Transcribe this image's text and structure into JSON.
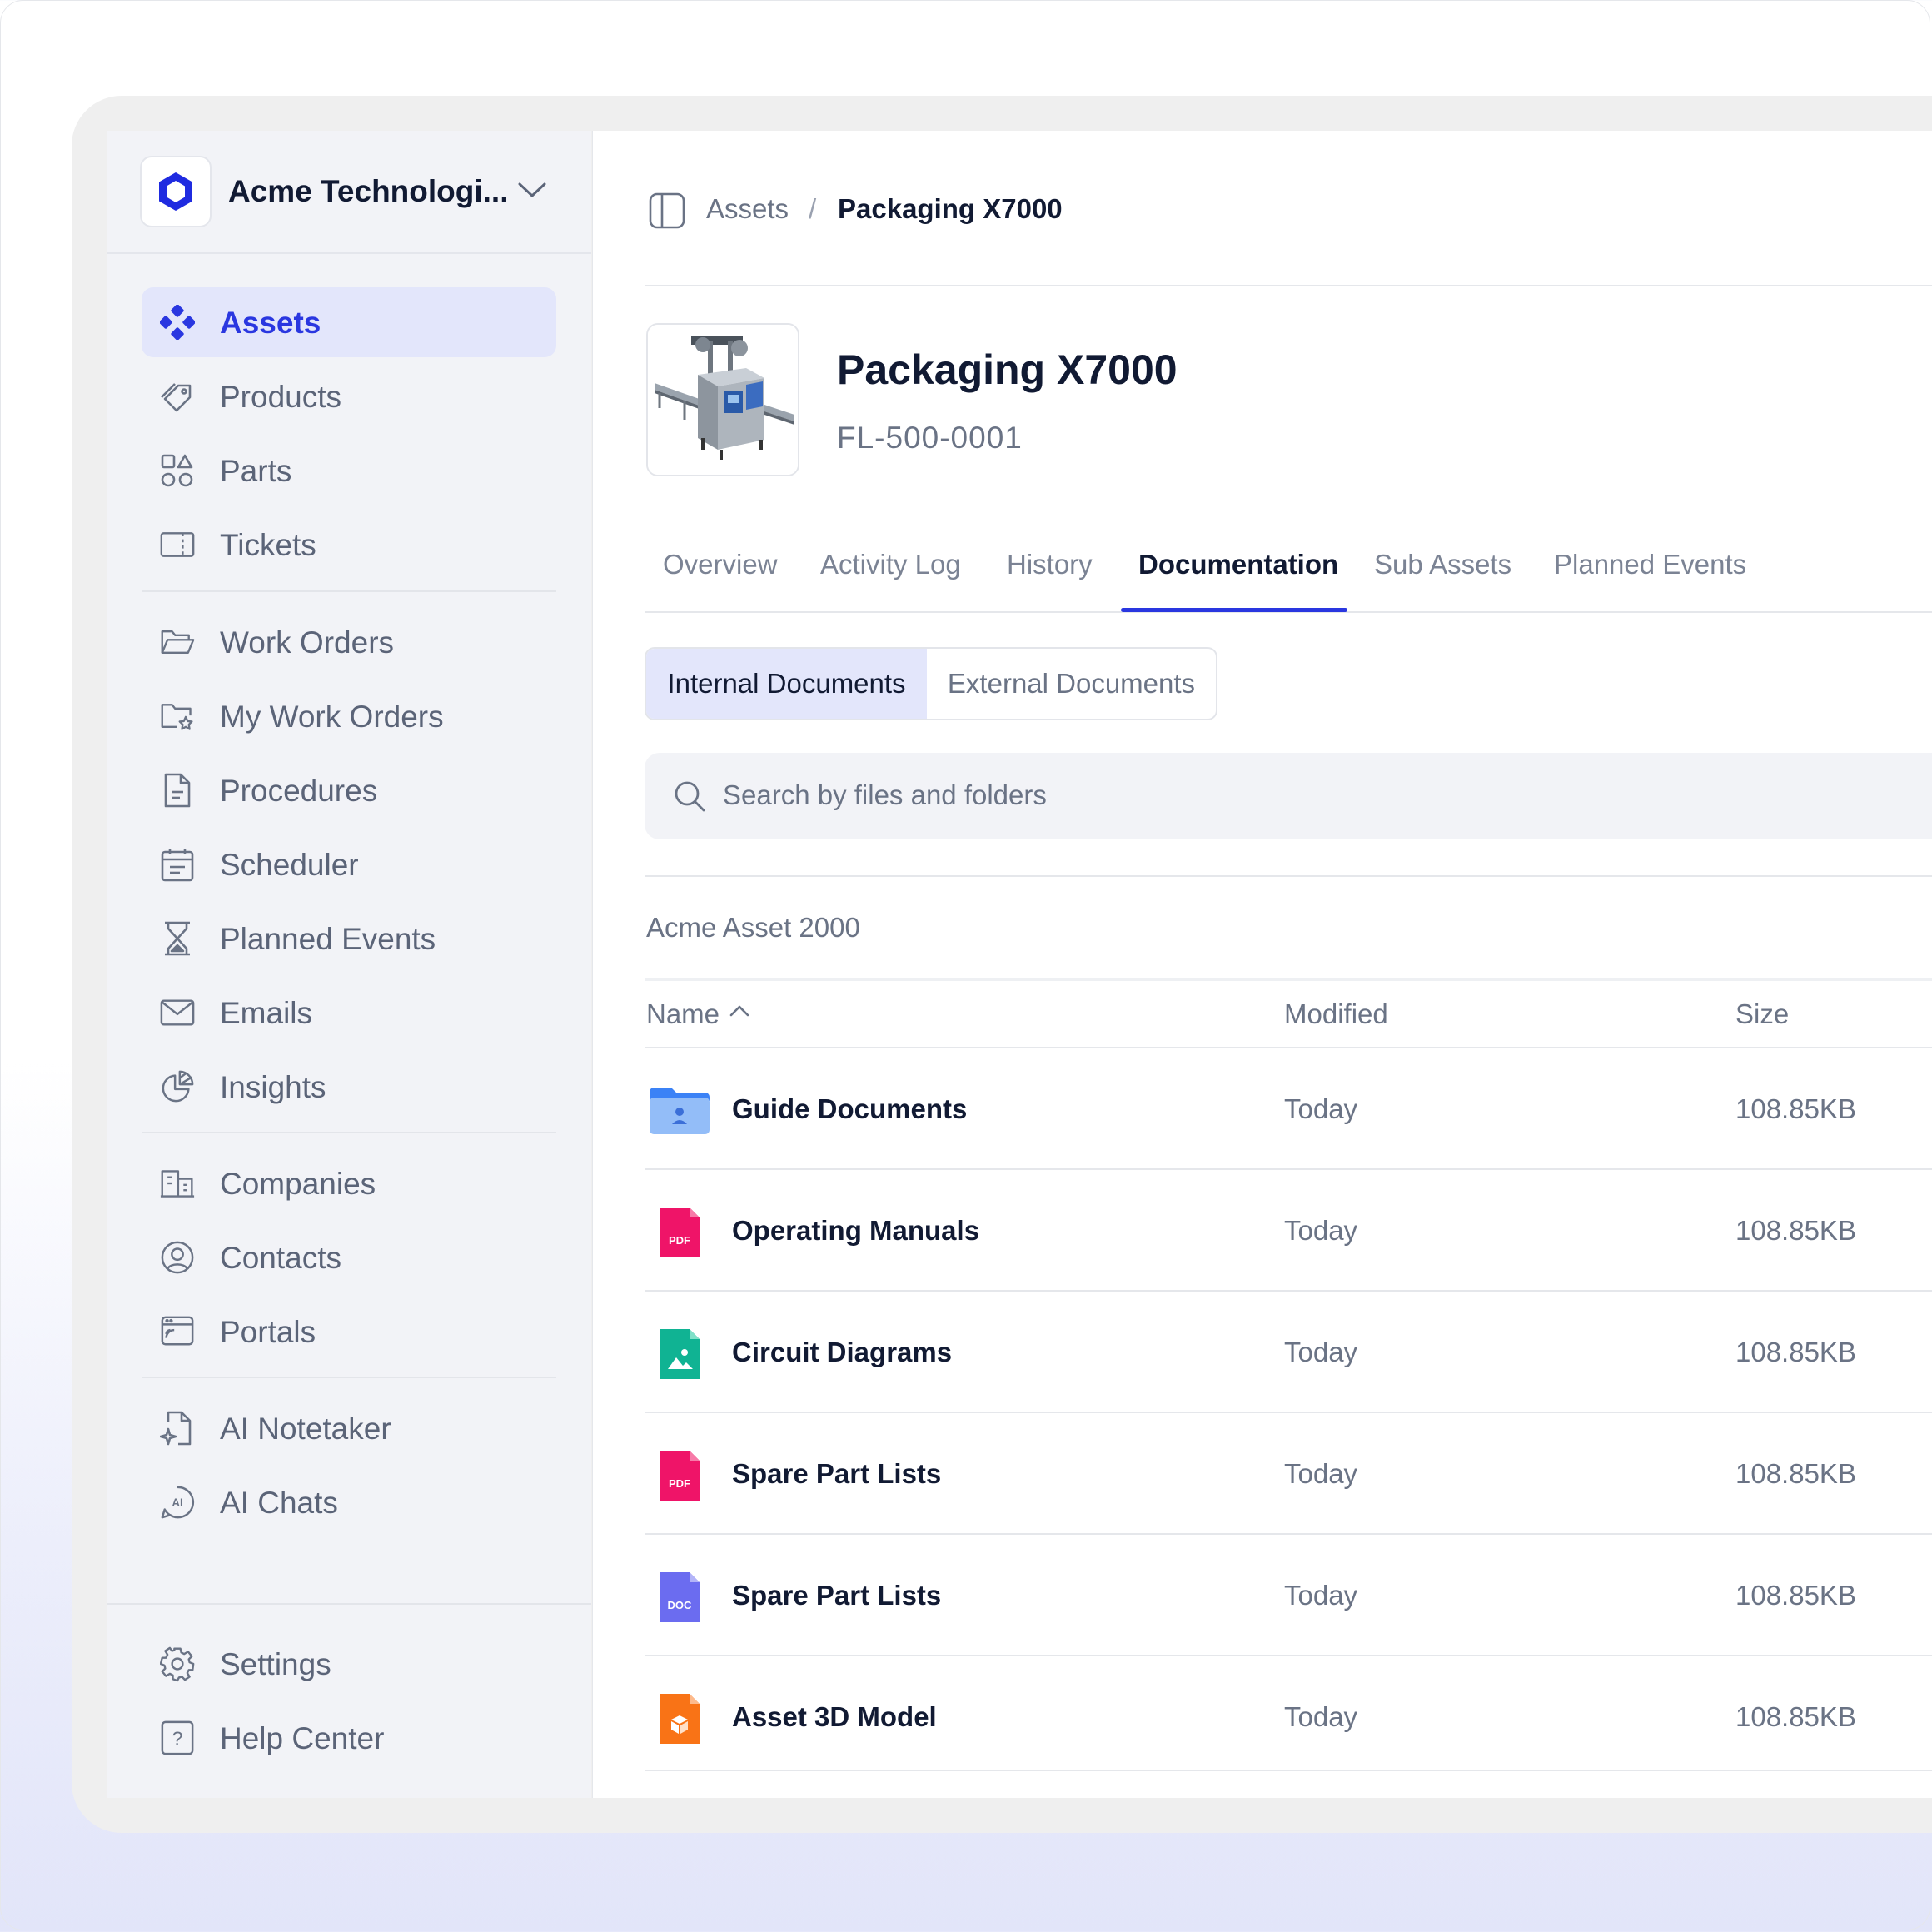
{
  "org": {
    "name": "Acme Technologi..."
  },
  "sidebar": {
    "items": [
      {
        "label": "Assets",
        "icon": "assets-icon",
        "active": true
      },
      {
        "label": "Products",
        "icon": "tag-icon"
      },
      {
        "label": "Parts",
        "icon": "shapes-icon"
      },
      {
        "label": "Tickets",
        "icon": "ticket-icon"
      },
      {
        "label": "Work Orders",
        "icon": "folder-open-icon"
      },
      {
        "label": "My Work Orders",
        "icon": "folder-star-icon"
      },
      {
        "label": "Procedures",
        "icon": "document-icon"
      },
      {
        "label": "Scheduler",
        "icon": "calendar-icon"
      },
      {
        "label": "Planned Events",
        "icon": "hourglass-icon"
      },
      {
        "label": "Emails",
        "icon": "mail-icon"
      },
      {
        "label": "Insights",
        "icon": "pie-chart-icon"
      },
      {
        "label": "Companies",
        "icon": "building-icon"
      },
      {
        "label": "Contacts",
        "icon": "user-circle-icon"
      },
      {
        "label": "Portals",
        "icon": "portal-icon"
      },
      {
        "label": "AI Notetaker",
        "icon": "ai-note-icon"
      },
      {
        "label": "AI Chats",
        "icon": "ai-chat-icon"
      }
    ],
    "footer": [
      {
        "label": "Settings",
        "icon": "gear-icon"
      },
      {
        "label": "Help Center",
        "icon": "help-icon"
      }
    ]
  },
  "breadcrumb": {
    "parent": "Assets",
    "separator": "/",
    "current": "Packaging X7000"
  },
  "asset": {
    "title": "Packaging X7000",
    "code": "FL-500-0001"
  },
  "tabs": [
    "Overview",
    "Activity Log",
    "History",
    "Documentation",
    "Sub Assets",
    "Planned Events"
  ],
  "active_tab": "Documentation",
  "doc_toggle": {
    "internal": "Internal Documents",
    "external": "External Documents"
  },
  "search": {
    "placeholder": "Search by files and folders"
  },
  "folder_label": "Acme Asset 2000",
  "table": {
    "headers": {
      "name": "Name",
      "modified": "Modified",
      "size": "Size"
    },
    "rows": [
      {
        "name": "Guide Documents",
        "modified": "Today",
        "size": "108.85KB",
        "type": "folder"
      },
      {
        "name": "Operating Manuals",
        "modified": "Today",
        "size": "108.85KB",
        "type": "PDF"
      },
      {
        "name": "Circuit Diagrams",
        "modified": "Today",
        "size": "108.85KB",
        "type": "image"
      },
      {
        "name": "Spare Part Lists",
        "modified": "Today",
        "size": "108.85KB",
        "type": "PDF"
      },
      {
        "name": "Spare Part Lists",
        "modified": "Today",
        "size": "108.85KB",
        "type": "DOC"
      },
      {
        "name": "Asset 3D Model",
        "modified": "Today",
        "size": "108.85KB",
        "type": "3d"
      }
    ]
  },
  "colors": {
    "accent": "#2a37e0",
    "active_bg": "#e3e6fb",
    "pdf": "#ef1468",
    "image": "#10b393",
    "doc": "#6b6cf0",
    "model": "#f97316",
    "folder": "#5b9cf5"
  }
}
